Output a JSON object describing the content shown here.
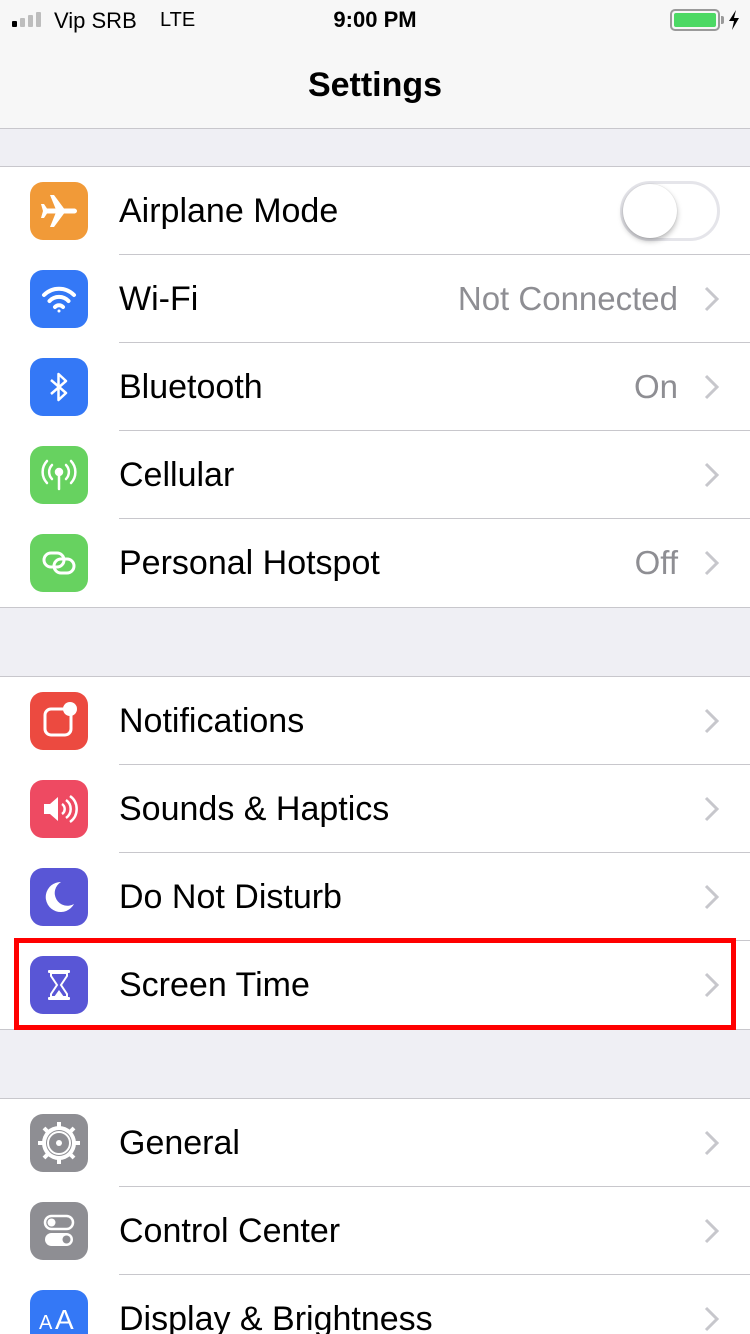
{
  "status_bar": {
    "carrier": "Vip SRB",
    "network": "LTE",
    "time": "9:00 PM",
    "signal_bars": 4,
    "signal_bars_active": 1,
    "battery_charging": true,
    "battery_color": "#4cd964"
  },
  "nav": {
    "title": "Settings"
  },
  "groups": [
    [
      {
        "label": "Airplane Mode",
        "icon": "airplane-icon",
        "color": "#f19a38",
        "toggle": true,
        "toggle_on": false
      },
      {
        "label": "Wi-Fi",
        "value": "Not Connected",
        "icon": "wifi-icon",
        "color": "#3478f6"
      },
      {
        "label": "Bluetooth",
        "value": "On",
        "icon": "bluetooth-icon",
        "color": "#3478f6"
      },
      {
        "label": "Cellular",
        "icon": "cellular-antenna-icon",
        "color": "#67d260"
      },
      {
        "label": "Personal Hotspot",
        "value": "Off",
        "icon": "hotspot-link-icon",
        "color": "#67d260"
      }
    ],
    [
      {
        "label": "Notifications",
        "icon": "notifications-icon",
        "color": "#ec4a40"
      },
      {
        "label": "Sounds & Haptics",
        "icon": "speaker-icon",
        "color": "#ee4a62"
      },
      {
        "label": "Do Not Disturb",
        "icon": "moon-icon",
        "color": "#5956d6"
      },
      {
        "label": "Screen Time",
        "icon": "hourglass-icon",
        "color": "#5956d6",
        "highlighted": true
      }
    ],
    [
      {
        "label": "General",
        "icon": "gear-icon",
        "color": "#8e8e93"
      },
      {
        "label": "Control Center",
        "icon": "toggles-icon",
        "color": "#8e8e93"
      },
      {
        "label": "Display & Brightness",
        "icon": "text-size-icon",
        "color": "#3478f6"
      }
    ]
  ]
}
